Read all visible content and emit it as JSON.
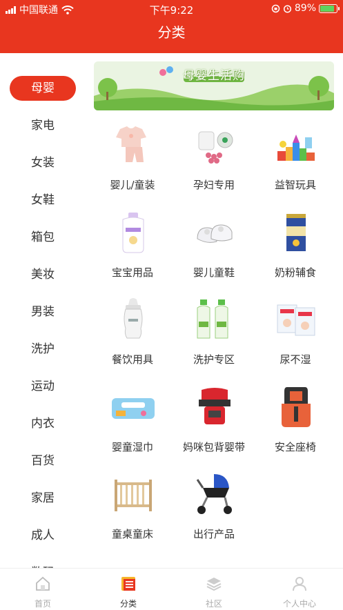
{
  "status_bar": {
    "carrier": "中国联通",
    "time": "下午9:22",
    "battery": "89%"
  },
  "header": {
    "title": "分类"
  },
  "sidebar": {
    "items": [
      {
        "label": "母婴",
        "active": true
      },
      {
        "label": "家电"
      },
      {
        "label": "女装"
      },
      {
        "label": "女鞋"
      },
      {
        "label": "箱包"
      },
      {
        "label": "美妆"
      },
      {
        "label": "男装"
      },
      {
        "label": "洗护"
      },
      {
        "label": "运动"
      },
      {
        "label": "内衣"
      },
      {
        "label": "百货"
      },
      {
        "label": "家居"
      },
      {
        "label": "成人"
      },
      {
        "label": "数码"
      }
    ]
  },
  "banner": {
    "title": "母婴生活购"
  },
  "categories": [
    {
      "label": "婴儿/童装",
      "icon": "baby-clothes-icon"
    },
    {
      "label": "孕妇专用",
      "icon": "maternity-icon"
    },
    {
      "label": "益智玩具",
      "icon": "toy-blocks-icon"
    },
    {
      "label": "宝宝用品",
      "icon": "baby-lotion-icon"
    },
    {
      "label": "婴儿童鞋",
      "icon": "baby-shoes-icon"
    },
    {
      "label": "奶粉辅食",
      "icon": "milk-powder-icon"
    },
    {
      "label": "餐饮用具",
      "icon": "baby-bottle-icon"
    },
    {
      "label": "洗护专区",
      "icon": "detergent-icon"
    },
    {
      "label": "尿不湿",
      "icon": "diaper-icon"
    },
    {
      "label": "婴童湿巾",
      "icon": "wet-wipes-icon"
    },
    {
      "label": "妈咪包背婴带",
      "icon": "baby-carrier-icon"
    },
    {
      "label": "安全座椅",
      "icon": "car-seat-icon"
    },
    {
      "label": "童桌童床",
      "icon": "crib-icon"
    },
    {
      "label": "出行产品",
      "icon": "stroller-icon"
    }
  ],
  "tabbar": {
    "items": [
      {
        "label": "首页",
        "icon": "home-icon"
      },
      {
        "label": "分类",
        "icon": "category-icon",
        "active": true
      },
      {
        "label": "社区",
        "icon": "community-icon"
      },
      {
        "label": "个人中心",
        "icon": "profile-icon"
      }
    ]
  },
  "colors": {
    "accent": "#e8361f",
    "text": "#333333",
    "muted": "#aaaaaa"
  }
}
